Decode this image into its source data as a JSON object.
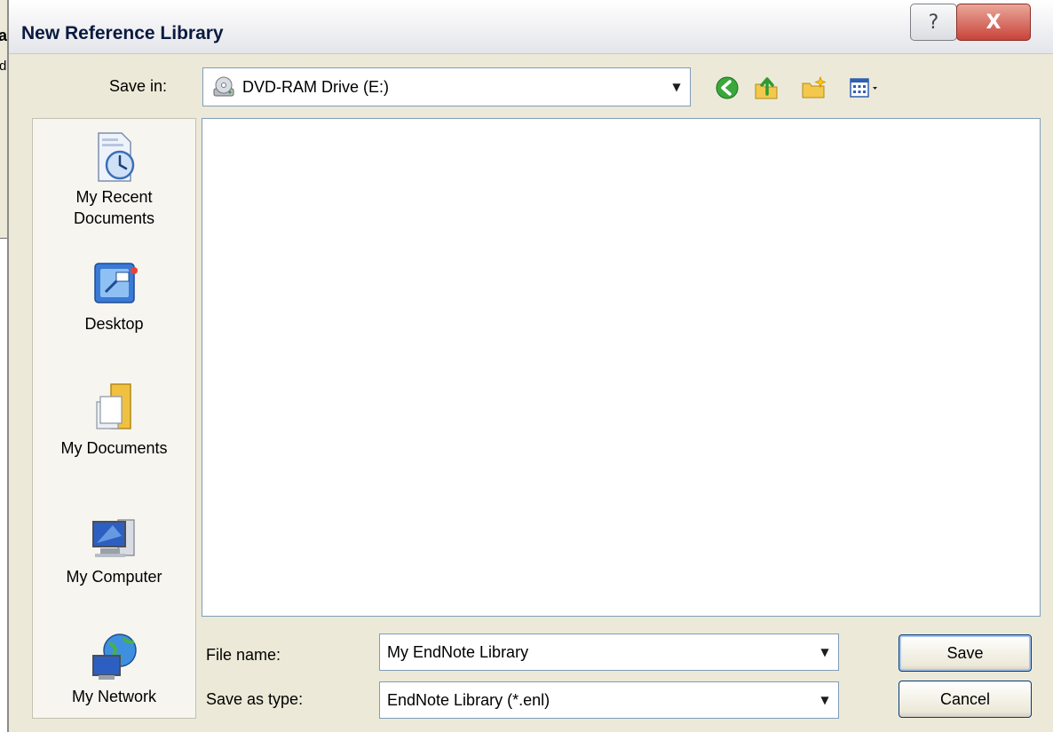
{
  "background_window": {
    "title_fragment": "ar",
    "text_fragment": "di"
  },
  "dialog": {
    "title": "New Reference Library",
    "help_glyph": "?",
    "close_glyph": "X"
  },
  "save_in": {
    "label": "Save in:",
    "value": "DVD-RAM Drive (E:)",
    "icon": "dvd-drive-icon"
  },
  "toolbar": {
    "icons": [
      "back-icon",
      "up-folder-icon",
      "new-folder-icon",
      "views-menu-icon"
    ]
  },
  "places": [
    {
      "label": "My Recent Documents",
      "line1": "My Recent",
      "line2": "Documents",
      "icon": "recent-documents-icon"
    },
    {
      "label": "Desktop",
      "line1": "Desktop",
      "line2": "",
      "icon": "desktop-icon"
    },
    {
      "label": "My Documents",
      "line1": "My Documents",
      "line2": "",
      "icon": "my-documents-icon"
    },
    {
      "label": "My Computer",
      "line1": "My Computer",
      "line2": "",
      "icon": "my-computer-icon"
    },
    {
      "label": "My Network",
      "line1": "My Network",
      "line2": "",
      "icon": "my-network-icon"
    }
  ],
  "file_name": {
    "label": "File name:",
    "value": "My EndNote Library"
  },
  "save_as_type": {
    "label": "Save as type:",
    "value": "EndNote Library (*.enl)"
  },
  "buttons": {
    "save": "Save",
    "cancel": "Cancel"
  },
  "colors": {
    "dialog_bg": "#ece9d8",
    "field_border": "#7f9db9",
    "close_red": "#c9433a"
  }
}
